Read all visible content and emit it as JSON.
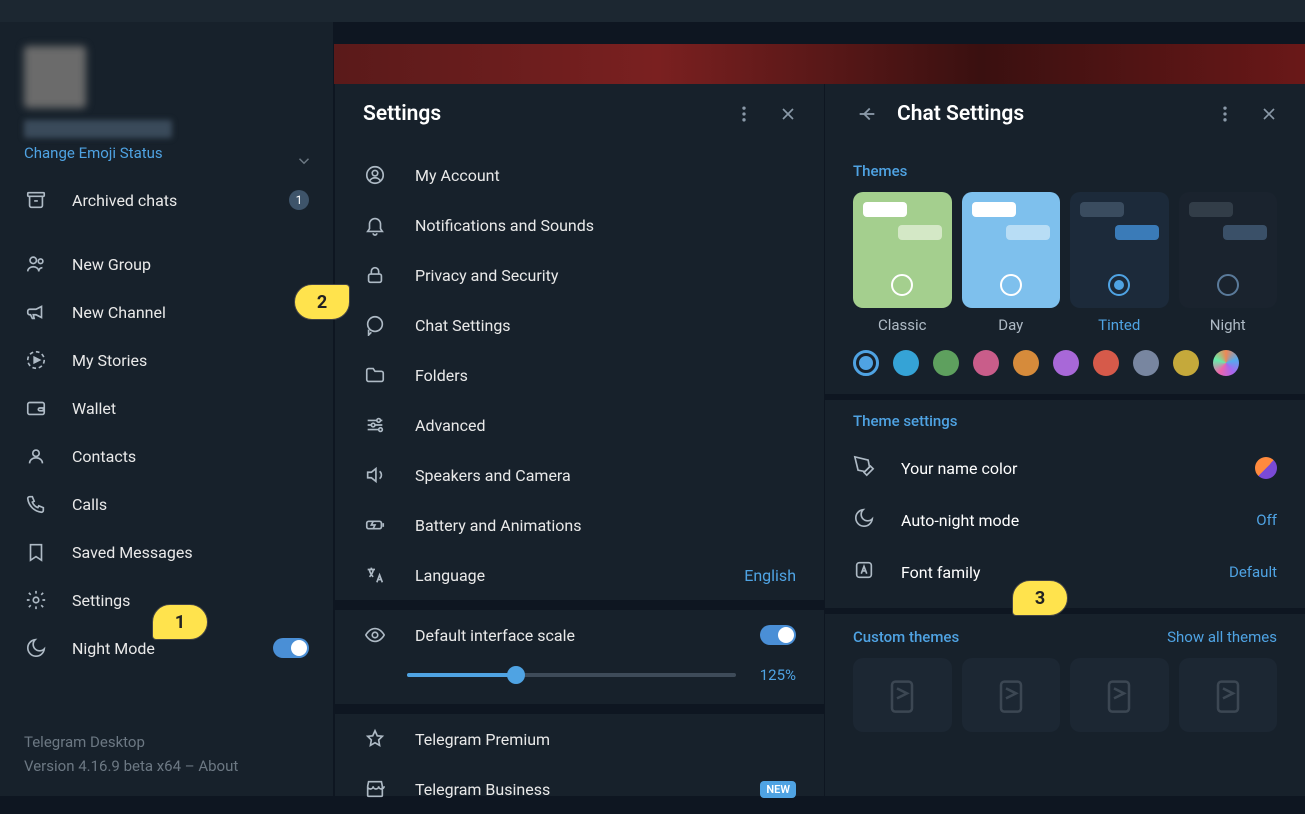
{
  "sidebar": {
    "emoji_status": "Change Emoji Status",
    "archived": {
      "label": "Archived chats",
      "count": "1"
    },
    "items": [
      {
        "label": "New Group",
        "icon": "users"
      },
      {
        "label": "New Channel",
        "icon": "megaphone"
      },
      {
        "label": "My Stories",
        "icon": "stories"
      },
      {
        "label": "Wallet",
        "icon": "wallet"
      },
      {
        "label": "Contacts",
        "icon": "contact"
      },
      {
        "label": "Calls",
        "icon": "phone"
      },
      {
        "label": "Saved Messages",
        "icon": "bookmark"
      },
      {
        "label": "Settings",
        "icon": "gear"
      },
      {
        "label": "Night Mode",
        "icon": "moon"
      }
    ],
    "footer": {
      "app": "Telegram Desktop",
      "version": "Version 4.16.9 beta x64 – About"
    }
  },
  "settings": {
    "title": "Settings",
    "items": [
      {
        "label": "My Account",
        "icon": "account"
      },
      {
        "label": "Notifications and Sounds",
        "icon": "bell"
      },
      {
        "label": "Privacy and Security",
        "icon": "lock"
      },
      {
        "label": "Chat Settings",
        "icon": "chat"
      },
      {
        "label": "Folders",
        "icon": "folder"
      },
      {
        "label": "Advanced",
        "icon": "sliders"
      },
      {
        "label": "Speakers and Camera",
        "icon": "speaker"
      },
      {
        "label": "Battery and Animations",
        "icon": "battery"
      },
      {
        "label": "Language",
        "icon": "language",
        "value": "English"
      }
    ],
    "scale": {
      "label": "Default interface scale",
      "value": "125%"
    },
    "premium": {
      "label": "Telegram Premium"
    },
    "business": {
      "label": "Telegram Business",
      "badge": "NEW"
    }
  },
  "chat_settings": {
    "title": "Chat Settings",
    "themes_header": "Themes",
    "themes": [
      {
        "name": "Classic"
      },
      {
        "name": "Day"
      },
      {
        "name": "Tinted"
      },
      {
        "name": "Night"
      }
    ],
    "colors": [
      "#4fa3e3",
      "#35a3d6",
      "#5ea05e",
      "#c95d8a",
      "#d68b3b",
      "#a868d8",
      "#d65a4a",
      "#7886a0",
      "#c5a93b"
    ],
    "theme_settings_header": "Theme settings",
    "name_color": "Your name color",
    "auto_night": {
      "label": "Auto-night mode",
      "value": "Off"
    },
    "font_family": {
      "label": "Font family",
      "value": "Default"
    },
    "custom_header": "Custom themes",
    "show_all": "Show all themes"
  },
  "callouts": {
    "c1": "1",
    "c2": "2",
    "c3": "3"
  }
}
